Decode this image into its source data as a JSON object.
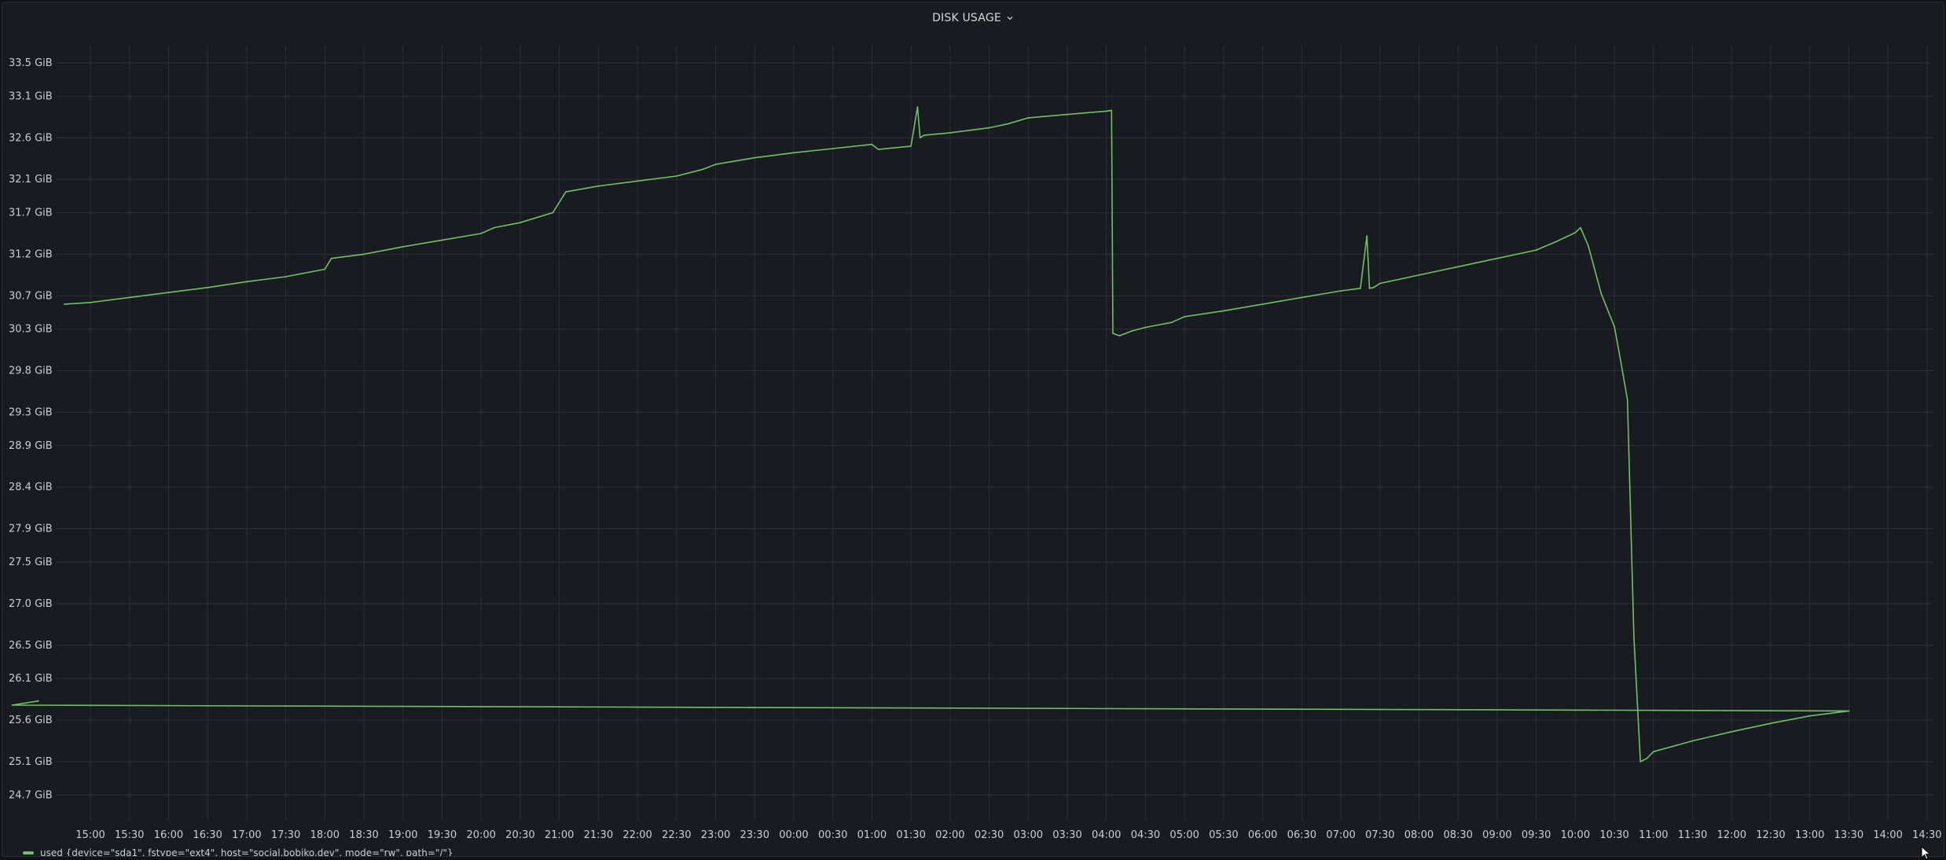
{
  "panel": {
    "title": "DISK USAGE",
    "chevron_icon": "chevron-down-icon"
  },
  "legend": {
    "label": "used {device=\"sda1\", fstype=\"ext4\", host=\"social.bobiko.dev\", mode=\"rw\", path=\"/\"}",
    "color": "#73bf69"
  },
  "colors": {
    "background": "#181b1f",
    "grid": "#2c3036",
    "series": "#73bf69",
    "text": "#ccccdc"
  },
  "chart_data": {
    "type": "line",
    "title": "DISK USAGE",
    "grid": true,
    "legend_position": "bottom-left",
    "y_unit": "GiB",
    "ylim": [
      24.4,
      33.85
    ],
    "y_ticks": [
      {
        "value": 33.5,
        "label": "33.5 GiB"
      },
      {
        "value": 33.1,
        "label": "33.1 GiB"
      },
      {
        "value": 32.6,
        "label": "32.6 GiB"
      },
      {
        "value": 32.1,
        "label": "32.1 GiB"
      },
      {
        "value": 31.7,
        "label": "31.7 GiB"
      },
      {
        "value": 31.2,
        "label": "31.2 GiB"
      },
      {
        "value": 30.7,
        "label": "30.7 GiB"
      },
      {
        "value": 30.3,
        "label": "30.3 GiB"
      },
      {
        "value": 29.8,
        "label": "29.8 GiB"
      },
      {
        "value": 29.3,
        "label": "29.3 GiB"
      },
      {
        "value": 28.9,
        "label": "28.9 GiB"
      },
      {
        "value": 28.4,
        "label": "28.4 GiB"
      },
      {
        "value": 27.9,
        "label": "27.9 GiB"
      },
      {
        "value": 27.5,
        "label": "27.5 GiB"
      },
      {
        "value": 27.0,
        "label": "27.0 GiB"
      },
      {
        "value": 26.5,
        "label": "26.5 GiB"
      },
      {
        "value": 26.1,
        "label": "26.1 GiB"
      },
      {
        "value": 25.6,
        "label": "25.6 GiB"
      },
      {
        "value": 25.1,
        "label": "25.1 GiB"
      },
      {
        "value": 24.7,
        "label": "24.7 GiB"
      }
    ],
    "x_ticks": [
      "15:00",
      "15:30",
      "16:00",
      "16:30",
      "17:00",
      "17:30",
      "18:00",
      "18:30",
      "19:00",
      "19:30",
      "20:00",
      "20:30",
      "21:00",
      "21:30",
      "22:00",
      "22:30",
      "23:00",
      "23:30",
      "00:00",
      "00:30",
      "01:00",
      "01:30",
      "02:00",
      "02:30",
      "03:00",
      "03:30",
      "04:00",
      "04:30",
      "05:00",
      "05:30",
      "06:00",
      "06:30",
      "07:00",
      "07:30",
      "08:00",
      "08:30",
      "09:00",
      "09:30",
      "10:00",
      "10:30",
      "11:00",
      "11:30",
      "12:00",
      "12:30",
      "13:00",
      "13:30",
      "14:00",
      "14:30"
    ],
    "series": [
      {
        "name": "used {device=\"sda1\", fstype=\"ext4\", host=\"social.bobiko.dev\", mode=\"rw\", path=\"/\"}",
        "x": [
          "14:40",
          "15:00",
          "15:30",
          "16:00",
          "16:30",
          "17:00",
          "17:30",
          "18:00",
          "18:05",
          "18:30",
          "19:00",
          "19:30",
          "20:00",
          "20:10",
          "20:30",
          "20:55",
          "21:05",
          "21:30",
          "22:00",
          "22:30",
          "22:50",
          "23:00",
          "23:30",
          "00:00",
          "00:30",
          "01:00",
          "01:05",
          "01:30",
          "01:35",
          "01:37",
          "01:40",
          "02:00",
          "02:30",
          "02:45",
          "03:00",
          "03:30",
          "04:00",
          "04:04",
          "04:05",
          "04:10",
          "04:20",
          "04:30",
          "04:50",
          "05:00",
          "05:30",
          "06:00",
          "06:30",
          "07:00",
          "07:15",
          "07:20",
          "07:22",
          "07:25",
          "07:30",
          "08:00",
          "08:30",
          "09:00",
          "09:30",
          "09:45",
          "10:00",
          "10:04",
          "10:10",
          "10:20",
          "10:30",
          "10:35",
          "10:40",
          "10:45",
          "10:50",
          "10:55",
          "11:00",
          "11:30",
          "12:00",
          "12:30",
          "13:00",
          "13:30",
          "14:00",
          "14:20"
        ],
        "values": [
          30.6,
          30.62,
          30.68,
          30.74,
          30.8,
          30.87,
          30.93,
          31.02,
          31.15,
          31.2,
          31.29,
          31.37,
          31.45,
          31.52,
          31.58,
          31.7,
          31.95,
          32.02,
          32.08,
          32.14,
          32.22,
          32.28,
          32.36,
          32.42,
          32.47,
          32.52,
          32.46,
          32.5,
          32.97,
          32.6,
          32.63,
          32.66,
          32.72,
          32.77,
          32.84,
          32.88,
          32.92,
          32.93,
          30.25,
          30.22,
          30.28,
          30.32,
          30.38,
          30.45,
          30.52,
          30.6,
          30.68,
          30.76,
          30.79,
          31.42,
          30.79,
          30.8,
          30.85,
          30.95,
          31.05,
          31.15,
          31.25,
          31.35,
          31.46,
          31.52,
          31.3,
          30.72,
          30.33,
          29.9,
          29.45,
          26.6,
          25.1,
          25.14,
          25.22,
          25.35,
          25.46,
          25.56,
          25.65,
          25.71,
          25.78,
          25.83
        ]
      }
    ]
  }
}
